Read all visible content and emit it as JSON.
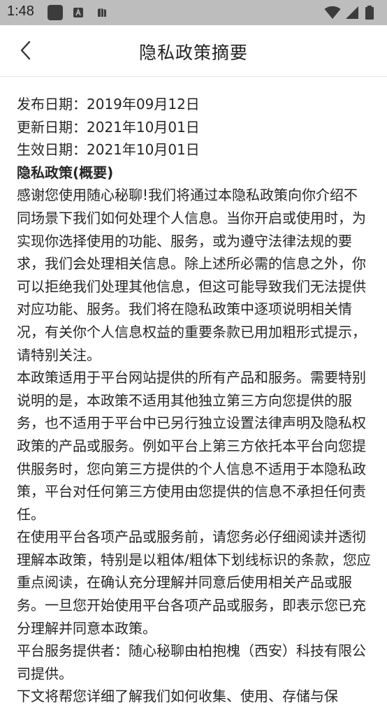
{
  "status_bar": {
    "time": "1:48",
    "icons": [
      "app-icon",
      "keyboard-icon",
      "storage-icon",
      "wifi-icon",
      "signal-icon",
      "battery-icon"
    ]
  },
  "header": {
    "back_icon": "chevron-left-icon",
    "title": "隐私政策摘要"
  },
  "content": {
    "publish_date": "发布日期：2019年09月12日",
    "update_date": "更新日期：2021年10月01日",
    "effective_date": "生效日期：2021年10月01日",
    "section_heading": "隐私政策(概要)",
    "paragraphs": [
      "感谢您使用随心秘聊!我们将通过本隐私政策向你介绍不同场景下我们如何处理个人信息。当你开启或使用时，为实现你选择使用的功能、服务，或为遵守法律法规的要求，我们会处理相关信息。除上述所必需的信息之外，你可以拒绝我们处理其他信息，但这可能导致我们无法提供对应功能、服务。我们将在隐私政策中逐项说明相关情况，有关你个人信息权益的重要条款已用加粗形式提示，请特别关注。",
      "本政策适用于平台网站提供的所有产品和服务。需要特别说明的是，本政策不适用其他独立第三方向您提供的服务，也不适用于平台中已另行独立设置法律声明及隐私权政策的产品或服务。例如平台上第三方依托本平台向您提供服务时，您向第三方提供的个人信息不适用于本隐私政策，平台对任何第三方使用由您提供的信息不承担任何责任。",
      "在使用平台各项产品或服务前，请您务必仔细阅读并透彻理解本政策，特别是以粗体/粗体下划线标识的条款，您应重点阅读，在确认充分理解并同意后使用相关产品或服务。一旦您开始使用平台各项产品或服务，即表示您已充分理解并同意本政策。",
      "平台服务提供者：随心秘聊由柏抱槐（西安）科技有限公司提供。",
      "下文将帮您详细了解我们如何收集、使用、存储与保"
    ]
  },
  "colors": {
    "status_bar_bg": "#bdbdbd",
    "background": "#ffffff",
    "text": "#262626",
    "divider": "#e3e3e3"
  }
}
